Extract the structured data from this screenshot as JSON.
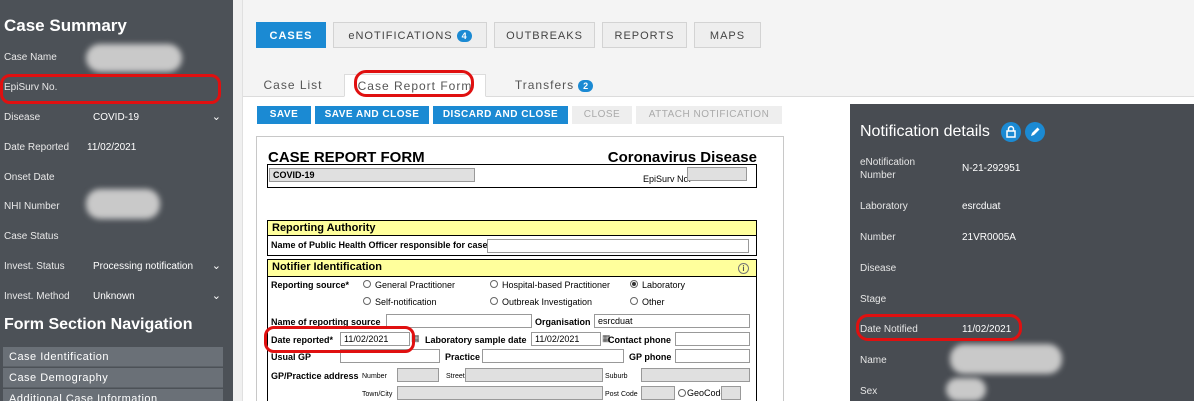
{
  "sidebar": {
    "title": "Case Summary",
    "fields": [
      {
        "label": "Case Name",
        "value": ""
      },
      {
        "label": "EpiSurv No.",
        "value": ""
      },
      {
        "label": "Disease",
        "value": "COVID-19"
      },
      {
        "label": "Date Reported",
        "value": "11/02/2021"
      },
      {
        "label": "Onset Date",
        "value": ""
      },
      {
        "label": "NHI Number",
        "value": ""
      },
      {
        "label": "Case Status",
        "value": ""
      },
      {
        "label": "Invest. Status",
        "value": "Processing notification"
      },
      {
        "label": "Invest. Method",
        "value": "Unknown"
      }
    ],
    "nav_title": "Form Section Navigation",
    "nav_items": [
      "Case Identification",
      "Case Demography",
      "Additional Case Information"
    ]
  },
  "top_tabs": [
    {
      "label": "CASES",
      "active": true
    },
    {
      "label": "eNOTIFICATIONS",
      "badge": "4"
    },
    {
      "label": "OUTBREAKS"
    },
    {
      "label": "REPORTS"
    },
    {
      "label": "MAPS"
    }
  ],
  "sub_tabs": [
    {
      "label": "Case List"
    },
    {
      "label": "Case Report Form",
      "active": true
    },
    {
      "label": "Transfers",
      "badge": "2"
    }
  ],
  "actions": {
    "save": "SAVE",
    "save_close": "SAVE AND CLOSE",
    "discard_close": "DISCARD AND CLOSE",
    "close": "CLOSE",
    "attach": "ATTACH NOTIFICATION"
  },
  "form": {
    "title": "CASE REPORT FORM",
    "disease_title": "Coronavirus Disease",
    "disease_value": "COVID-19",
    "episurv_label": "EpiSurv No.",
    "reporting_authority": {
      "heading": "Reporting Authority",
      "officer_label": "Name of Public Health Officer responsible for case"
    },
    "notifier": {
      "heading": "Notifier Identification",
      "reporting_source_label": "Reporting source*",
      "sources": [
        {
          "label": "General Practitioner",
          "selected": false
        },
        {
          "label": "Hospital-based Practitioner",
          "selected": false
        },
        {
          "label": "Laboratory",
          "selected": true
        },
        {
          "label": "Self-notification",
          "selected": false
        },
        {
          "label": "Outbreak Investigation",
          "selected": false
        },
        {
          "label": "Other",
          "selected": false
        }
      ],
      "name_source_label": "Name of reporting source",
      "organisation_label": "Organisation",
      "organisation_value": "esrcduat",
      "date_reported_label": "Date reported*",
      "date_reported_value": "11/02/2021",
      "lab_sample_label": "Laboratory sample date",
      "lab_sample_value": "11/02/2021",
      "contact_phone_label": "Contact phone",
      "usual_gp_label": "Usual GP",
      "practice_label": "Practice",
      "gp_phone_label": "GP phone",
      "gp_address_label": "GP/Practice address",
      "number_label": "Number",
      "street_label": "Street",
      "suburb_label": "Suburb",
      "town_label": "Town/City",
      "postcode_label": "Post Code",
      "geocode_label": "GeoCode"
    }
  },
  "notification": {
    "title": "Notification details",
    "rows": [
      {
        "label": "eNotification Number",
        "value": "N-21-292951"
      },
      {
        "label": "Laboratory",
        "value": "esrcduat"
      },
      {
        "label": "Number",
        "value": "21VR0005A"
      },
      {
        "label": "Disease",
        "value": ""
      },
      {
        "label": "Stage",
        "value": ""
      },
      {
        "label": "Date Notified",
        "value": "11/02/2021"
      },
      {
        "label": "Name",
        "value": ""
      },
      {
        "label": "Sex",
        "value": ""
      }
    ]
  },
  "colors": {
    "accent": "#1b8ad3",
    "sidebar_bg": "#4c5157",
    "panel_bg": "#484c52",
    "section_yellow": "#ffff9c",
    "annotation_red": "#e01010"
  },
  "icons": {
    "lock": "lock-icon",
    "edit": "pencil-icon",
    "calendar": "calendar-icon",
    "chevron": "chevron-down-icon",
    "info": "info-icon"
  }
}
